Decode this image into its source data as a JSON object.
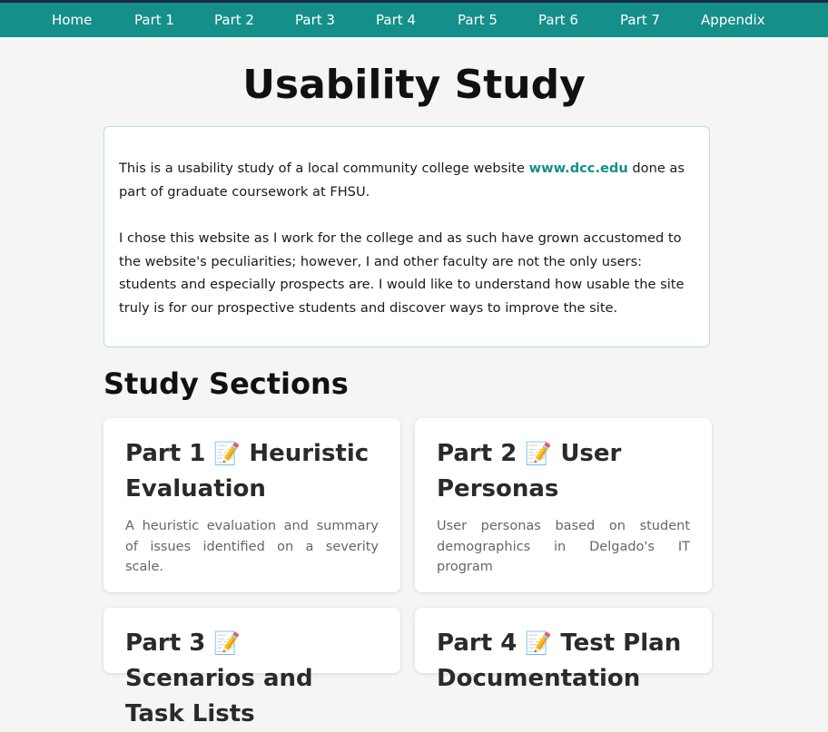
{
  "nav": {
    "items": [
      "Home",
      "Part 1",
      "Part 2",
      "Part 3",
      "Part 4",
      "Part 5",
      "Part 6",
      "Part 7",
      "Appendix"
    ]
  },
  "page": {
    "title": "Usability Study"
  },
  "intro": {
    "p1_before": "This is a usability study of a local community college website ",
    "link_text": "www.dcc.edu",
    "p1_after": " done as part of graduate coursework at FHSU.",
    "p2": "I chose this website as I work for the college and as such have grown accustomed to the website's peculiarities; however, I and other faculty are not the only users: students and especially prospects are. I would like to understand how usable the site truly is for our prospective students and discover ways to improve the site."
  },
  "sections": {
    "heading": "Study Sections",
    "cards": [
      {
        "part": "Part 1",
        "icon": "pencil-memo-icon",
        "emoji": "📝",
        "title": "Heuristic Evaluation",
        "desc": "A heuristic evaluation and summary of issues identified on a severity scale."
      },
      {
        "part": "Part 2",
        "icon": "pencil-memo-icon",
        "emoji": "📝",
        "title": "User Personas",
        "desc": "User personas based on student demographics in Delgado's IT program"
      },
      {
        "part": "Part 3",
        "icon": "pencil-memo-icon",
        "emoji": "📝",
        "title": "Scenarios and Task Lists",
        "desc": ""
      },
      {
        "part": "Part 4",
        "icon": "pencil-memo-icon",
        "emoji": "📝",
        "title": "Test Plan Documentation",
        "desc": ""
      }
    ]
  },
  "colors": {
    "nav_bg": "#158f89",
    "accent_link": "#178f88",
    "page_bg": "#f5f5f5"
  }
}
